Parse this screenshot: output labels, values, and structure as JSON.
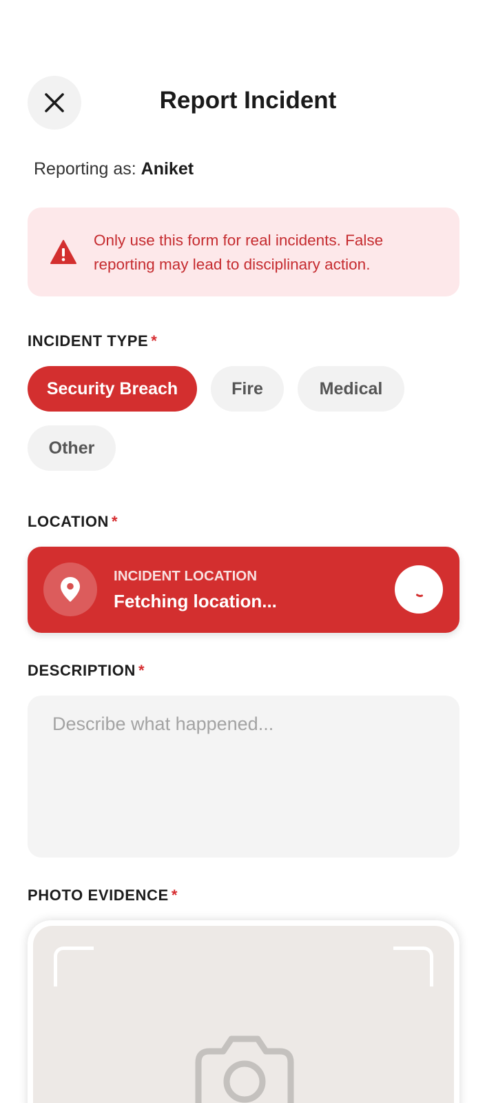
{
  "header": {
    "title": "Report Incident",
    "close_icon": "close-icon"
  },
  "reporter": {
    "prefix": "Reporting as:",
    "name": "Aniket"
  },
  "warning": {
    "icon": "warning-triangle-icon",
    "text": "Only use this form for real incidents. False reporting may lead to disciplinary action."
  },
  "incident_type": {
    "label": "INCIDENT TYPE",
    "required_mark": "*",
    "options": [
      "Security Breach",
      "Fire",
      "Medical",
      "Other"
    ],
    "selected": "Security Breach"
  },
  "location": {
    "label": "LOCATION",
    "required_mark": "*",
    "caption": "INCIDENT LOCATION",
    "value": "Fetching location...",
    "pin_icon": "location-pin-icon",
    "status_icon": "loading-spinner-icon"
  },
  "description": {
    "label": "DESCRIPTION",
    "required_mark": "*",
    "placeholder": "Describe what happened...",
    "value": ""
  },
  "photo": {
    "label": "PHOTO EVIDENCE",
    "required_mark": "*",
    "icon": "camera-icon"
  },
  "colors": {
    "accent": "#d32f2f",
    "warning_bg": "#fde8ea",
    "warning_text": "#c52b2f",
    "chip_bg": "#f2f2f2"
  }
}
